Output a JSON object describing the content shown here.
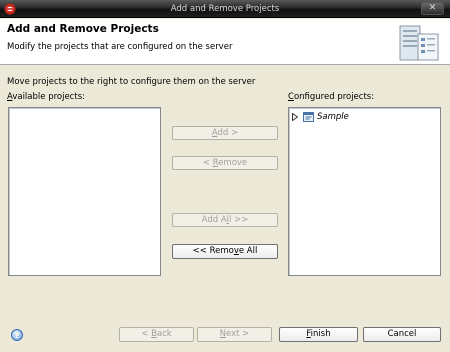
{
  "window": {
    "title": "Add and Remove Projects",
    "close_glyph": "✕"
  },
  "header": {
    "title": "Add and Remove Projects",
    "description": "Modify the projects that are configured on the server"
  },
  "instruction": "Move projects to the right to configure them on the server",
  "available": {
    "label_accel": "A",
    "label_rest": "vailable projects:",
    "items": []
  },
  "configured": {
    "label_accel": "C",
    "label_rest": "onfigured projects:",
    "items": [
      {
        "label": "Sample",
        "expanded": false
      }
    ]
  },
  "buttons": {
    "add": {
      "label_pre": "",
      "label_accel": "A",
      "label_post": "dd >",
      "enabled": false
    },
    "remove": {
      "label_pre": "< ",
      "label_accel": "R",
      "label_post": "emove",
      "enabled": false
    },
    "add_all": {
      "label_pre": "Add A",
      "label_accel": "l",
      "label_post": "l >>",
      "enabled": false
    },
    "remove_all": {
      "label_pre": "<< Remo",
      "label_accel": "v",
      "label_post": "e All",
      "enabled": true
    }
  },
  "footer": {
    "help_glyph": "?",
    "back": {
      "label_pre": "< ",
      "label_accel": "B",
      "label_post": "ack",
      "enabled": false
    },
    "next": {
      "label_pre": "",
      "label_accel": "N",
      "label_post": "ext >",
      "enabled": false
    },
    "finish": {
      "label_pre": "",
      "label_accel": "F",
      "label_post": "inish",
      "enabled": true
    },
    "cancel": {
      "label": "Cancel",
      "enabled": true
    }
  },
  "colors": {
    "dialog_bg": "#ece9d8",
    "titlebar": "#1e1e1e",
    "disabled_text": "#a0a0a0"
  }
}
